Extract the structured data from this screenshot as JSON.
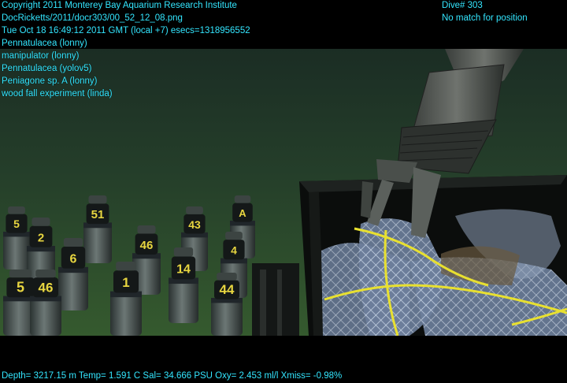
{
  "overlay": {
    "lines_left": [
      "Copyright 2011 Monterey Bay Aquarium Research Institute",
      "DocRicketts/2011/docr303/00_52_12_08.png",
      "Tue Oct 18 16:49:12 2011 GMT (local +7)  esecs=1318956552",
      "Pennatulacea (lonny)",
      "manipulator (lonny)",
      "Pennatulacea (yolov5)",
      "Peniagone sp. A (lonny)",
      "wood fall experiment (linda)"
    ],
    "lines_right": [
      "Dive# 303",
      "No match for position"
    ],
    "footer": "Depth= 3217.15 m  Temp= 1.591 C  Sal= 34.666 PSU  Oxy= 2.453 ml/l  Xmiss= -0.98%"
  },
  "scene": {
    "canister_labels": [
      "5",
      "2",
      "51",
      "43",
      "46",
      "6",
      "46",
      "5",
      "4",
      "14",
      "1",
      "44",
      "A"
    ],
    "colors": {
      "overlay_text": "#33e6ff",
      "seafloor": "#1f3a22",
      "rope": "#e8e030"
    }
  }
}
